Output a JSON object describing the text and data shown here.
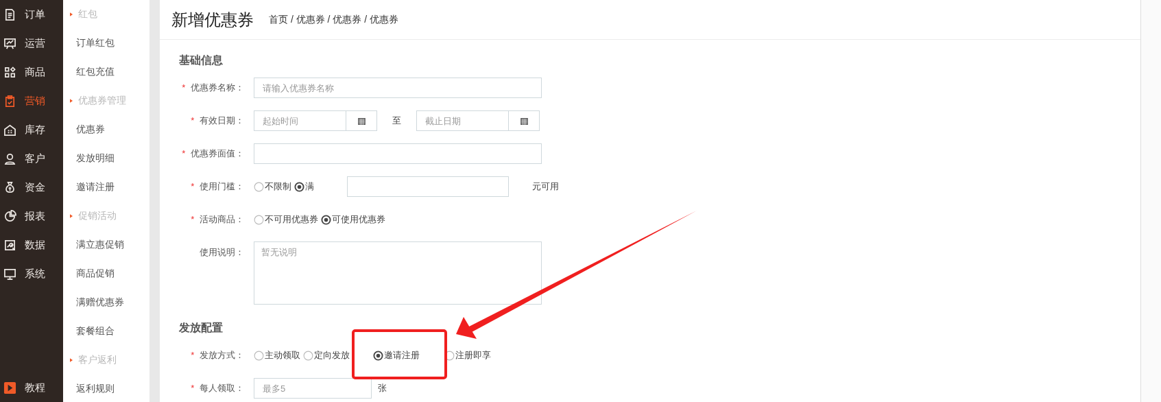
{
  "main_nav": [
    {
      "label": "订单",
      "selected": false
    },
    {
      "label": "运营",
      "selected": false
    },
    {
      "label": "商品",
      "selected": false
    },
    {
      "label": "营销",
      "selected": true
    },
    {
      "label": "库存",
      "selected": false
    },
    {
      "label": "客户",
      "selected": false
    },
    {
      "label": "资金",
      "selected": false
    },
    {
      "label": "报表",
      "selected": false
    },
    {
      "label": "数据",
      "selected": false
    },
    {
      "label": "系统",
      "selected": false
    }
  ],
  "tutorial": {
    "label": "教程"
  },
  "sub_nav": [
    {
      "label": "红包",
      "children": [
        {
          "label": "订单红包"
        },
        {
          "label": "红包充值"
        }
      ]
    },
    {
      "label": "优惠券管理",
      "children": [
        {
          "label": "优惠券"
        },
        {
          "label": "发放明细"
        },
        {
          "label": "邀请注册"
        }
      ]
    },
    {
      "label": "促销活动",
      "children": [
        {
          "label": "满立惠促销"
        },
        {
          "label": "商品促销"
        },
        {
          "label": "满赠优惠券"
        },
        {
          "label": "套餐组合"
        }
      ]
    },
    {
      "label": "客户返利",
      "children": [
        {
          "label": "返利规则"
        }
      ]
    }
  ],
  "page": {
    "title": "新增优惠券",
    "breadcrumb": "首页 / 优惠券 / 优惠券 / 优惠券"
  },
  "sections": [
    {
      "title": "基础信息",
      "fields": [
        {
          "kind": "text",
          "mark": "*",
          "label": "优惠券名称：",
          "placeholder": "请输入优惠券名称"
        },
        {
          "kind": "daterange",
          "mark": "*",
          "label": "有效日期：",
          "from_placeholder": "起始时间",
          "separator": "至",
          "to_placeholder": "截止日期"
        },
        {
          "kind": "text",
          "mark": "*",
          "label": "优惠券面值："
        },
        {
          "kind": "radio_input",
          "mark": "*",
          "label": "使用门槛：",
          "options": [
            {
              "label": "不限制",
              "selected": false
            },
            {
              "label": "满",
              "selected": true
            }
          ],
          "suffix": "元可用"
        },
        {
          "kind": "radios",
          "mark": "*",
          "label": "活动商品：",
          "options": [
            {
              "label": "不可用优惠券",
              "selected": false
            },
            {
              "label": "可使用优惠券",
              "selected": true
            }
          ]
        },
        {
          "kind": "textarea",
          "label": "使用说明：",
          "placeholder": "暂无说明"
        }
      ]
    },
    {
      "title": "发放配置",
      "fields": [
        {
          "kind": "radios",
          "mark": "*",
          "label": "发放方式：",
          "options": [
            {
              "label": "主动领取",
              "selected": false
            },
            {
              "label": "定向发放",
              "selected": false
            },
            {
              "label": "邀请注册",
              "selected": true
            },
            {
              "label": "注册即享",
              "selected": false
            }
          ]
        },
        {
          "kind": "short_text",
          "mark": "*",
          "label": "每人领取：",
          "placeholder": "最多5",
          "suffix": "张"
        }
      ]
    }
  ]
}
